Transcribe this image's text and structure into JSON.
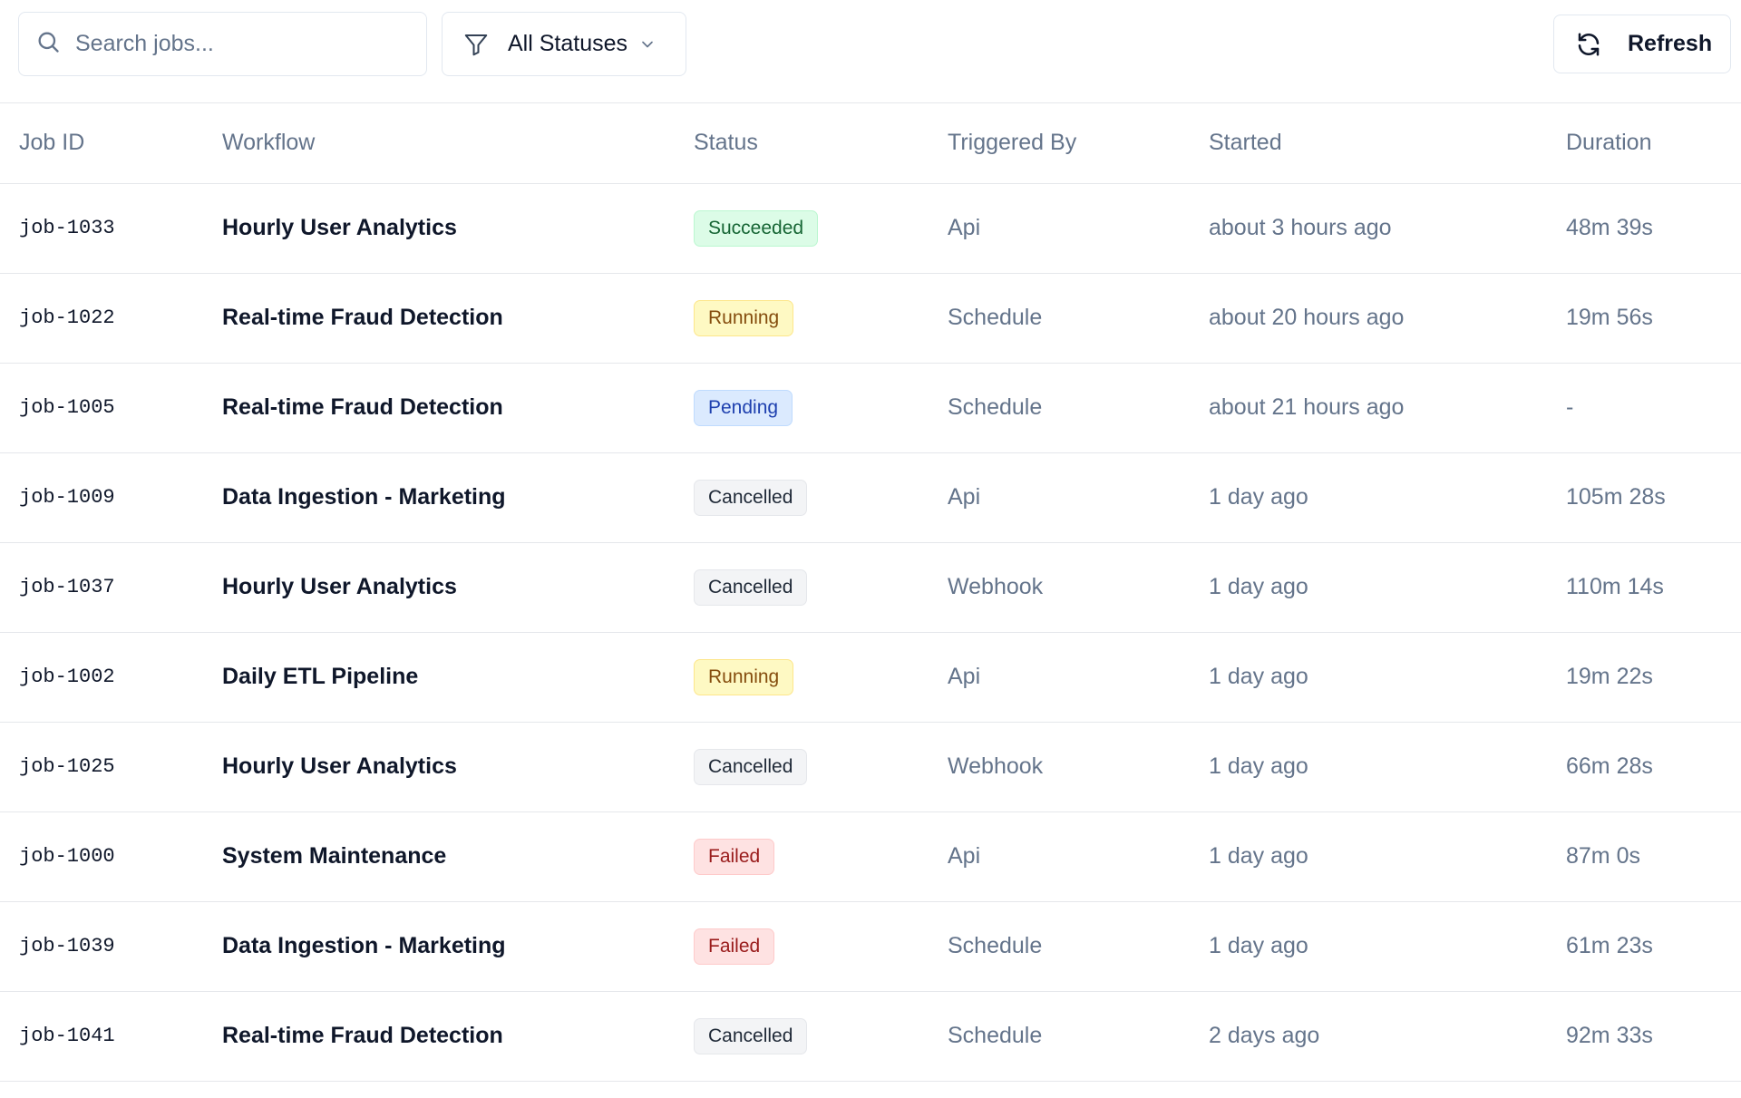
{
  "toolbar": {
    "search_placeholder": "Search jobs...",
    "filter_label": "All Statuses",
    "refresh_label": "Refresh"
  },
  "table": {
    "columns": [
      "Job ID",
      "Workflow",
      "Status",
      "Triggered By",
      "Started",
      "Duration"
    ],
    "rows": [
      {
        "id": "job-1033",
        "workflow": "Hourly User Analytics",
        "status": "Succeeded",
        "trigger": "Api",
        "started": "about 3 hours ago",
        "duration": "48m 39s"
      },
      {
        "id": "job-1022",
        "workflow": "Real-time Fraud Detection",
        "status": "Running",
        "trigger": "Schedule",
        "started": "about 20 hours ago",
        "duration": "19m 56s"
      },
      {
        "id": "job-1005",
        "workflow": "Real-time Fraud Detection",
        "status": "Pending",
        "trigger": "Schedule",
        "started": "about 21 hours ago",
        "duration": "-"
      },
      {
        "id": "job-1009",
        "workflow": "Data Ingestion - Marketing",
        "status": "Cancelled",
        "trigger": "Api",
        "started": "1 day ago",
        "duration": "105m 28s"
      },
      {
        "id": "job-1037",
        "workflow": "Hourly User Analytics",
        "status": "Cancelled",
        "trigger": "Webhook",
        "started": "1 day ago",
        "duration": "110m 14s"
      },
      {
        "id": "job-1002",
        "workflow": "Daily ETL Pipeline",
        "status": "Running",
        "trigger": "Api",
        "started": "1 day ago",
        "duration": "19m 22s"
      },
      {
        "id": "job-1025",
        "workflow": "Hourly User Analytics",
        "status": "Cancelled",
        "trigger": "Webhook",
        "started": "1 day ago",
        "duration": "66m 28s"
      },
      {
        "id": "job-1000",
        "workflow": "System Maintenance",
        "status": "Failed",
        "trigger": "Api",
        "started": "1 day ago",
        "duration": "87m 0s"
      },
      {
        "id": "job-1039",
        "workflow": "Data Ingestion - Marketing",
        "status": "Failed",
        "trigger": "Schedule",
        "started": "1 day ago",
        "duration": "61m 23s"
      },
      {
        "id": "job-1041",
        "workflow": "Real-time Fraud Detection",
        "status": "Cancelled",
        "trigger": "Schedule",
        "started": "2 days ago",
        "duration": "92m 33s"
      }
    ]
  },
  "icons": {
    "search": "search-icon",
    "filter": "filter-icon",
    "chevron": "chevron-down-icon",
    "refresh": "refresh-icon"
  },
  "colors": {
    "border": "#e2e8f0",
    "muted_text": "#64748b",
    "primary_text": "#0f172a",
    "succeeded_bg": "#dcfce7",
    "running_bg": "#fef9c3",
    "pending_bg": "#dbeafe",
    "cancelled_bg": "#f3f4f6",
    "failed_bg": "#fee2e2"
  }
}
